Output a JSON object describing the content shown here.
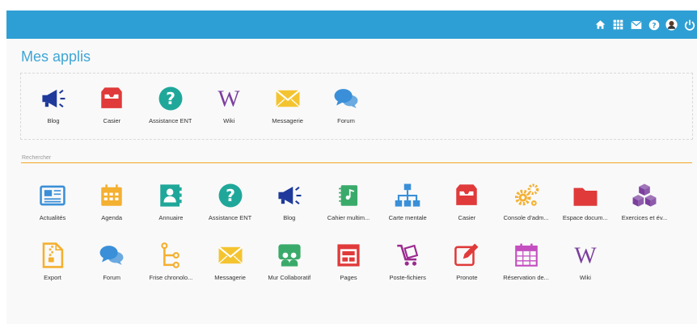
{
  "page_title": "Mes applis",
  "topbar": {
    "icons": [
      "home-icon",
      "apps-grid-icon",
      "mail-icon",
      "help-icon",
      "avatar-icon",
      "power-icon"
    ],
    "color": "#2e9fd4"
  },
  "favorites": [
    {
      "label": "Blog",
      "icon": "megaphone-icon",
      "color": "#1f3a9b"
    },
    {
      "label": "Casier",
      "icon": "inbox-tray-icon",
      "color": "#e03a3a"
    },
    {
      "label": "Assistance ENT",
      "icon": "question-circle-icon",
      "color": "#1fa79a"
    },
    {
      "label": "Wiki",
      "icon": "wikipedia-w-icon",
      "color": "#7b3f9e"
    },
    {
      "label": "Messagerie",
      "icon": "envelope-icon",
      "color": "#f4c430"
    },
    {
      "label": "Forum",
      "icon": "speech-bubbles-icon",
      "color": "#3a8fd8"
    }
  ],
  "search": {
    "placeholder": "Rechercher",
    "value": ""
  },
  "apps": [
    {
      "label": "Actualités",
      "icon": "newspaper-icon",
      "color": "#3a8fd8"
    },
    {
      "label": "Agenda",
      "icon": "calendar-icon",
      "color": "#f4b030"
    },
    {
      "label": "Annuaire",
      "icon": "contact-book-icon",
      "color": "#1fa79a"
    },
    {
      "label": "Assistance ENT",
      "icon": "question-circle-icon",
      "color": "#1fa79a"
    },
    {
      "label": "Blog",
      "icon": "megaphone-icon",
      "color": "#1f3a9b"
    },
    {
      "label": "Cahier multim...",
      "icon": "multimedia-notebook-icon",
      "color": "#3aaa6a"
    },
    {
      "label": "Carte mentale",
      "icon": "mind-map-icon",
      "color": "#3a8fd8"
    },
    {
      "label": "Casier",
      "icon": "inbox-tray-icon",
      "color": "#e03a3a"
    },
    {
      "label": "Console d'adm...",
      "icon": "gears-icon",
      "color": "#f4b030"
    },
    {
      "label": "Espace docum...",
      "icon": "folder-icon",
      "color": "#e03a3a"
    },
    {
      "label": "Exercices et év...",
      "icon": "cubes-icon",
      "color": "#7b3f9e"
    },
    {
      "label": "Export",
      "icon": "zip-file-icon",
      "color": "#f4b030"
    },
    {
      "label": "Forum",
      "icon": "speech-bubbles-icon",
      "color": "#3a8fd8"
    },
    {
      "label": "Frise chronolo...",
      "icon": "timeline-icon",
      "color": "#f4b030"
    },
    {
      "label": "Messagerie",
      "icon": "envelope-icon",
      "color": "#f4c430"
    },
    {
      "label": "Mur Collaboratif",
      "icon": "collaborative-wall-icon",
      "color": "#3aaa6a"
    },
    {
      "label": "Pages",
      "icon": "web-page-icon",
      "color": "#e03a3a"
    },
    {
      "label": "Poste-fichiers",
      "icon": "file-cart-icon",
      "color": "#9b2a8f"
    },
    {
      "label": "Pronote",
      "icon": "edit-square-icon",
      "color": "#e03a3a"
    },
    {
      "label": "Réservation de...",
      "icon": "booking-calendar-icon",
      "color": "#c44fc0"
    },
    {
      "label": "Wiki",
      "icon": "wikipedia-w-icon",
      "color": "#7b3f9e"
    }
  ]
}
